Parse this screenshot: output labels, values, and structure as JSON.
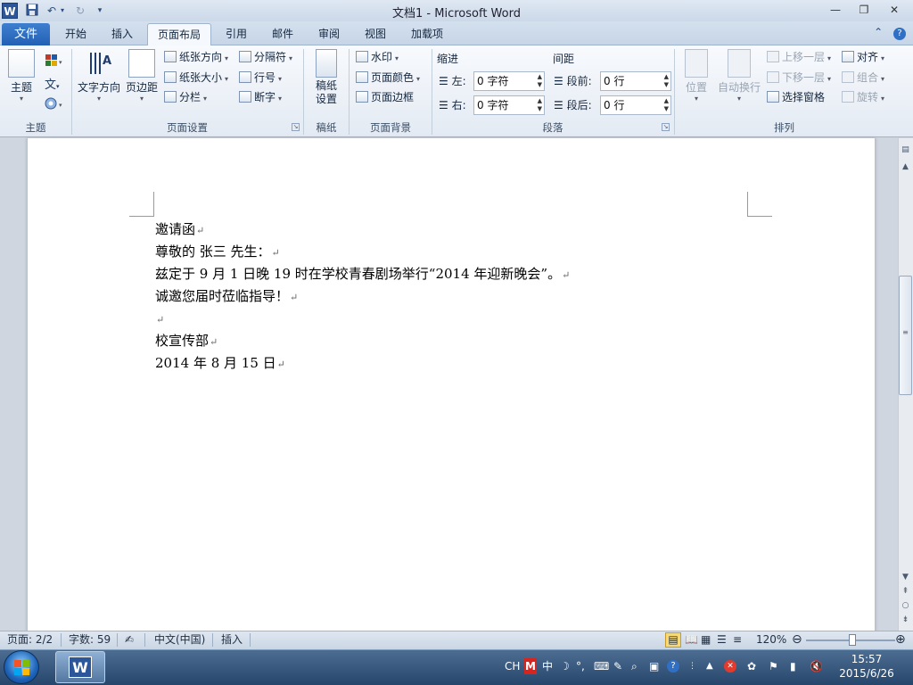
{
  "window": {
    "title": "文档1 - Microsoft Word",
    "app_icon": "W",
    "min": "—",
    "max": "❐",
    "close": "✕"
  },
  "tabs": [
    "文件",
    "开始",
    "插入",
    "页面布局",
    "引用",
    "邮件",
    "审阅",
    "视图",
    "加载项"
  ],
  "active_tab": "页面布局",
  "ribbon": {
    "theme": {
      "label": "主题",
      "group": "主题"
    },
    "page_setup": {
      "text_direction": "文字方向",
      "margins": "页边距",
      "orientation": "纸张方向",
      "size": "纸张大小",
      "columns": "分栏",
      "breaks": "分隔符",
      "line_numbers": "行号",
      "hyphenation": "断字",
      "group": "页面设置"
    },
    "manuscript": {
      "label1": "稿纸",
      "label2": "设置",
      "group": "稿纸"
    },
    "page_background": {
      "watermark": "水印",
      "page_color": "页面颜色",
      "page_borders": "页面边框",
      "group": "页面背景"
    },
    "paragraph": {
      "indent_title": "缩进",
      "spacing_title": "间距",
      "left_label": "左:",
      "right_label": "右:",
      "before_label": "段前:",
      "after_label": "段后:",
      "left_value": "0 字符",
      "right_value": "0 字符",
      "before_value": "0 行",
      "after_value": "0 行",
      "group": "段落"
    },
    "arrange": {
      "position": "位置",
      "wrap_text": "自动换行",
      "bring_forward": "上移一层",
      "send_backward": "下移一层",
      "selection_pane": "选择窗格",
      "align": "对齐",
      "group_btn": "组合",
      "rotate": "旋转",
      "group": "排列"
    }
  },
  "document": {
    "lines": [
      "邀请函",
      "尊敬的 张三 先生：",
      "兹定于 9 月 1 日晚 19 时在学校青春剧场举行“2014 年迎新晚会”。",
      "诚邀您届时莅临指导！",
      "",
      "校宣传部",
      "2014 年 8 月 15 日"
    ],
    "paragraph_mark": "↵"
  },
  "status": {
    "page": "页面: 2/2",
    "words": "字数: 59",
    "language": "中文(中国)",
    "mode": "插入",
    "zoom": "120%"
  },
  "taskbar": {
    "ime": "CH",
    "time": "15:57",
    "date": "2015/6/26"
  }
}
